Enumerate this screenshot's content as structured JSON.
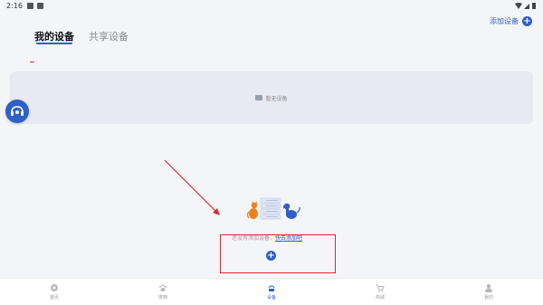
{
  "status_bar": {
    "time": "2:16"
  },
  "tabs": [
    {
      "label": "我的设备",
      "active": true
    },
    {
      "label": "共享设备",
      "active": false
    }
  ],
  "header": {
    "add_device_label": "添加设备"
  },
  "empty_state": {
    "label": "暂无设备"
  },
  "prompt": {
    "text": "还没有添加设备，",
    "link": "快去添加吧"
  },
  "bottom_nav": {
    "items": [
      {
        "label": "首页",
        "icon": "home-icon",
        "active": false
      },
      {
        "label": "宠物",
        "icon": "paw-icon",
        "active": false
      },
      {
        "label": "设备",
        "icon": "device-icon",
        "active": true
      },
      {
        "label": "商城",
        "icon": "cart-icon",
        "active": false
      },
      {
        "label": "我的",
        "icon": "profile-icon",
        "active": false
      }
    ]
  },
  "colors": {
    "accent": "#2f5fc7",
    "annotation_red": "#d42a2a",
    "cat": "#e8841f",
    "dog": "#2f5fc7"
  }
}
